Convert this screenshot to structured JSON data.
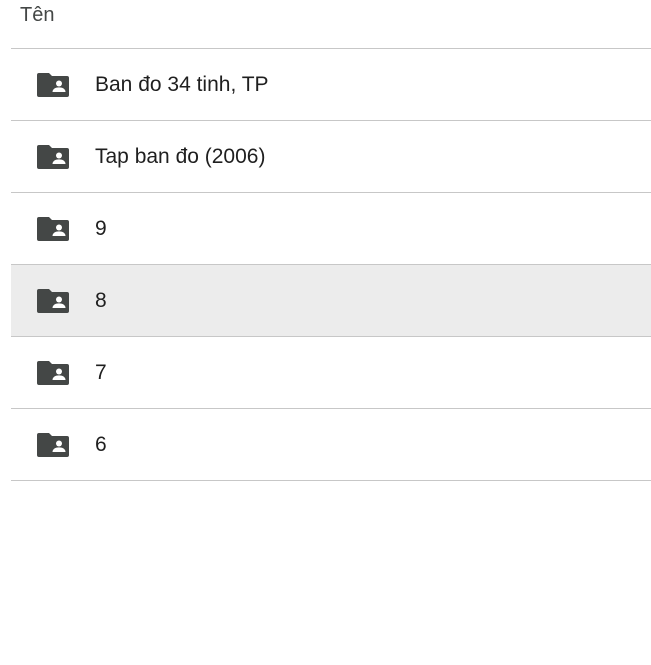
{
  "header": {
    "name_column_label": "Tên"
  },
  "rows": [
    {
      "label": "Ban đo 34 tinh, TP",
      "icon": "shared-folder-icon",
      "selected": false
    },
    {
      "label": "Tap ban đo (2006)",
      "icon": "shared-folder-icon",
      "selected": false
    },
    {
      "label": "9",
      "icon": "shared-folder-icon",
      "selected": false
    },
    {
      "label": "8",
      "icon": "shared-folder-icon",
      "selected": true
    },
    {
      "label": "7",
      "icon": "shared-folder-icon",
      "selected": false
    },
    {
      "label": "6",
      "icon": "shared-folder-icon",
      "selected": false
    }
  ],
  "colors": {
    "icon": "#444746",
    "divider": "#c7c7c7",
    "selected_row": "#ececec",
    "text": "#1f1f1f"
  }
}
